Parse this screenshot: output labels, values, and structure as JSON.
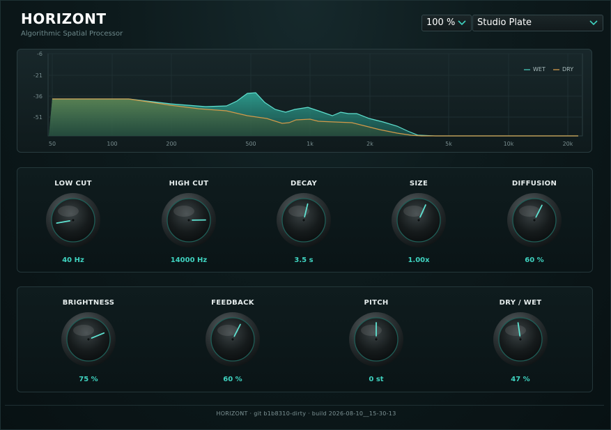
{
  "header": {
    "title": "HORIZONT",
    "subtitle": "Algorithmic Spatial Processor",
    "zoom": "100 %",
    "preset": "Studio Plate"
  },
  "colors": {
    "accent": "#3fd3c0",
    "wet": "#46c7b8",
    "dry": "#d39a4a",
    "value_text": "#3fd3c0"
  },
  "spectrum": {
    "y_ticks": [
      "-6",
      "-21",
      "-36",
      "-51"
    ],
    "x_ticks": [
      "50",
      "100",
      "200",
      "500",
      "1k",
      "2k",
      "5k",
      "10k",
      "20k"
    ],
    "legend": [
      {
        "name": "WET",
        "color": "#46c7b8"
      },
      {
        "name": "DRY",
        "color": "#d39a4a"
      }
    ]
  },
  "panel1": {
    "knobs": [
      {
        "label": "LOW CUT",
        "value": "40 Hz",
        "level": 0.13
      },
      {
        "label": "HIGH CUT",
        "value": "14000 Hz",
        "level": 0.83
      },
      {
        "label": "DECAY",
        "value": "3.5 s",
        "level": 0.55
      },
      {
        "label": "SIZE",
        "value": "1.00x",
        "level": 0.59
      },
      {
        "label": "DIFFUSION",
        "value": "60 %",
        "level": 0.6
      }
    ]
  },
  "panel2": {
    "knobs": [
      {
        "label": "BRIGHTNESS",
        "value": "75 %",
        "level": 0.75
      },
      {
        "label": "FEEDBACK",
        "value": "60 %",
        "level": 0.6
      },
      {
        "label": "PITCH",
        "value": "0 st",
        "level": 0.5
      },
      {
        "label": "DRY / WET",
        "value": "47 %",
        "level": 0.47
      }
    ]
  },
  "footer": {
    "text": "HORIZONT · git b1b8310-dirty · build 2026-08-10__15-30-13"
  }
}
